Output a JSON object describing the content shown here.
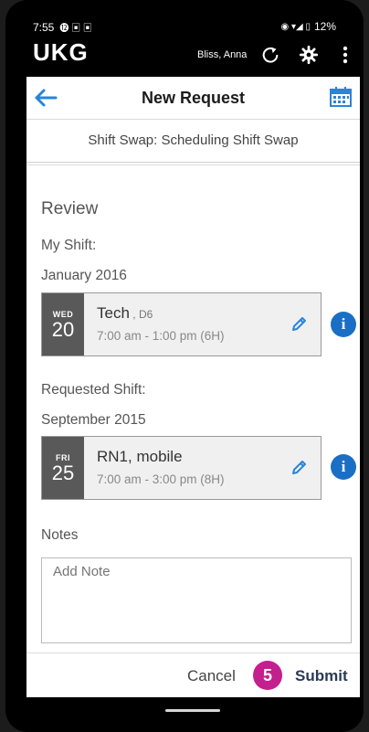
{
  "statusbar": {
    "time": "7:55",
    "battery": "12%"
  },
  "appbar": {
    "logo": "UKG",
    "user": "Bliss, Anna",
    "icons": [
      "refresh-icon",
      "gear-icon",
      "more-vert-icon"
    ]
  },
  "header": {
    "title": "New Request",
    "back_icon": "back-arrow-icon",
    "calendar_icon": "calendar-icon"
  },
  "subheader": "Shift Swap: Scheduling Shift Swap",
  "review": {
    "title": "Review",
    "my_shift_label": "My Shift:",
    "my_shift_month": "January 2016",
    "my_shift": {
      "dow": "WED",
      "day": "20",
      "job": "Tech",
      "location": "D6",
      "time": "7:00 am - 1:00 pm (6H)"
    },
    "requested_label": "Requested Shift:",
    "requested_month": "September 2015",
    "requested_shift": {
      "dow": "FRI",
      "day": "25",
      "job": "RN1, mobile",
      "time": "7:00 am - 3:00 pm (8H)"
    }
  },
  "notes": {
    "label": "Notes",
    "placeholder": "Add Note"
  },
  "footer": {
    "cancel": "Cancel",
    "step_badge": "5",
    "submit": "Submit"
  },
  "colors": {
    "accent_blue": "#1a6fc4",
    "badge_magenta": "#c31f8e",
    "datebox_gray": "#595959"
  }
}
